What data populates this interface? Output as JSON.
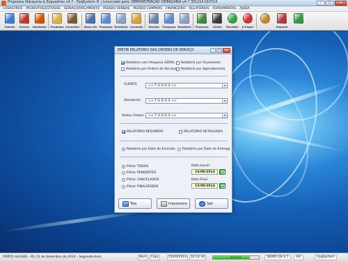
{
  "window": {
    "title": "Programa Vidraçaria & Esquadrias v4.7 - FpqSystem ® | Licenciado para: DEMONSTRAÇÃO VIDRAÇARIA v4.7 301214 010714"
  },
  "menu": [
    "CADASTROS",
    "PRODUTOS/ESTOQUE",
    "SERVIÇO/ORÇAMENTO",
    "PEDIDO VENDAS",
    "PEDIDO COMPRAS",
    "FINANCEIRO",
    "RELATÓRIOS",
    "FERRAMENTAS",
    "AJUDA"
  ],
  "toolbar": [
    {
      "label": "Cliente",
      "icon": "client-icon",
      "color": "#3a7bd5"
    },
    {
      "label": "Fornec",
      "icon": "supplier-icon",
      "color": "#c0392b"
    },
    {
      "label": "Vendedor",
      "icon": "seller-icon",
      "color": "#d35400"
    },
    {
      "label": "Produtos",
      "icon": "products-icon",
      "color": "#e0b040"
    },
    {
      "label": "Consultar",
      "icon": "consult-icon",
      "color": "#7a5a2a"
    },
    {
      "label": "Novo OS",
      "icon": "new-os-icon",
      "color": "#4a6fa8"
    },
    {
      "label": "Pesquisa",
      "icon": "search-icon",
      "color": "#5b8ccf"
    },
    {
      "label": "Relatório",
      "icon": "report-icon",
      "color": "#8aa2c4"
    },
    {
      "label": "Consulta",
      "icon": "query-icon",
      "color": "#d9a23a"
    },
    {
      "label": "Vendas",
      "icon": "sales-icon",
      "color": "#6b83a6"
    },
    {
      "label": "Pesquisa",
      "icon": "search-icon",
      "color": "#5b8ccf"
    },
    {
      "label": "Relatório",
      "icon": "report-icon",
      "color": "#8aa2c4"
    },
    {
      "label": "Financas",
      "icon": "finance-icon",
      "color": "#3c8a3c"
    },
    {
      "label": "CAIXA",
      "icon": "cashier-icon",
      "color": "#3a3a3a"
    },
    {
      "label": "Receber",
      "icon": "receive-icon",
      "color": "#2faa3a"
    },
    {
      "label": "A Pagar",
      "icon": "pay-icon",
      "color": "#d2332b"
    },
    {
      "label": "",
      "icon": "settings-icon",
      "color": "#c8862a"
    },
    {
      "label": "Suporte",
      "icon": "support-icon",
      "color": "#b03a3a"
    },
    {
      "label": "",
      "icon": "exit-icon",
      "color": "#2f9a3f"
    }
  ],
  "dialog": {
    "title": "EMITIR RELATÓRIO DAS ORDENS DE SERVIÇO",
    "report_checks": [
      {
        "label": "Relatório com Pesquisa GERAL",
        "checked": true
      },
      {
        "label": "Relatório por Orçamento",
        "checked": false
      },
      {
        "label": "Relatório por Ordem de Serviço",
        "checked": false
      },
      {
        "label": "Relatório por Agendamento",
        "checked": false
      }
    ],
    "filters": [
      {
        "label": "CLIENTE",
        "value": ">> T O D O S <<"
      },
      {
        "label": "Atendente",
        "value": ">> T O D O S <<"
      },
      {
        "label": "Status Ordem",
        "value": ">> T O D O S <<"
      }
    ],
    "summary_checked": {
      "label": "RELATÓRIO RESUMIDO",
      "checked": true
    },
    "detail_checked": {
      "label": "RELATÓRIO DETALHADO",
      "checked": false
    },
    "date_radios": [
      {
        "label": "Relatório por Data de Emissão",
        "selected": true
      },
      {
        "label": "Relatório por Data de Entrega",
        "selected": false
      }
    ],
    "status_radios": [
      {
        "label": "Filtrar TODOS",
        "selected": true
      },
      {
        "label": "Filtrar PENDENTES",
        "selected": false
      },
      {
        "label": "Filtrar CANCELADOS",
        "selected": false
      },
      {
        "label": "Filtrar FINALIZADOS",
        "selected": false
      }
    ],
    "date_start_label": "Data Inicial",
    "date_start": "16/08/2014",
    "date_end_label": "Data Final",
    "date_end": "15/09/2014",
    "buttons": {
      "screen": "Tela",
      "print": "Impressora",
      "exit": "Sair"
    }
  },
  "statusbar": {
    "location": "PORTO ALEGRE - RS 15 de Setembro de 2014 - Segunda-feira",
    "num": "Num",
    "caps": "Caps",
    "date": "15/09/2014",
    "time": "16:12:30",
    "db": "MASTER",
    "db_progress": 0.8,
    "version": "DEMO OS 4.7",
    "mode": "ER",
    "brand": "FpqSystem"
  }
}
